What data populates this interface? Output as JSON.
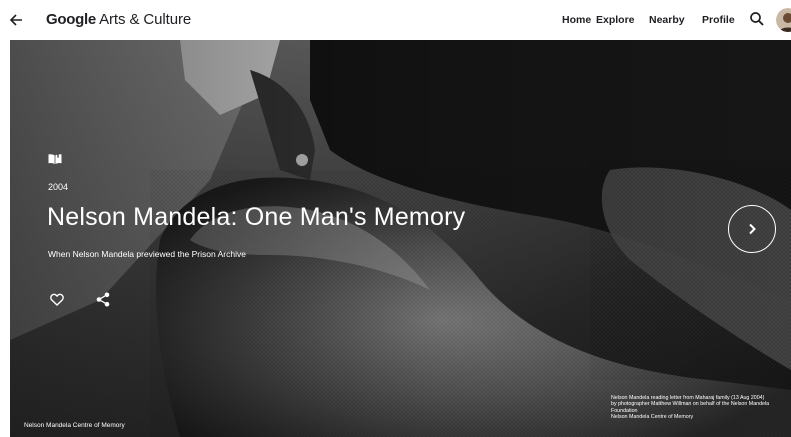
{
  "header": {
    "back_icon": "arrow-left-icon",
    "logo_google": "Google",
    "logo_rest": " Arts & Culture",
    "nav": [
      "Home",
      "Explore",
      "Nearby",
      "Profile"
    ],
    "search_icon": "search-icon"
  },
  "hero": {
    "type_icon": "open-book-icon",
    "year": "2004",
    "title": "Nelson Mandela: One Man's Memory",
    "subtitle": "When Nelson Mandela previewed the Prison Archive",
    "like_icon": "heart-outline-icon",
    "share_icon": "share-icon",
    "next_icon": "chevron-right-icon",
    "credit": "Nelson Mandela Centre of Memory",
    "caption": {
      "line1": "Nelson Mandela reading letter from Maharaj family (13 Aug 2004)",
      "line2": "by photographer Matthew Willman on behalf of the Nelson Mandela Foundation",
      "line3": "Nelson Mandela Centre of Memory"
    }
  }
}
